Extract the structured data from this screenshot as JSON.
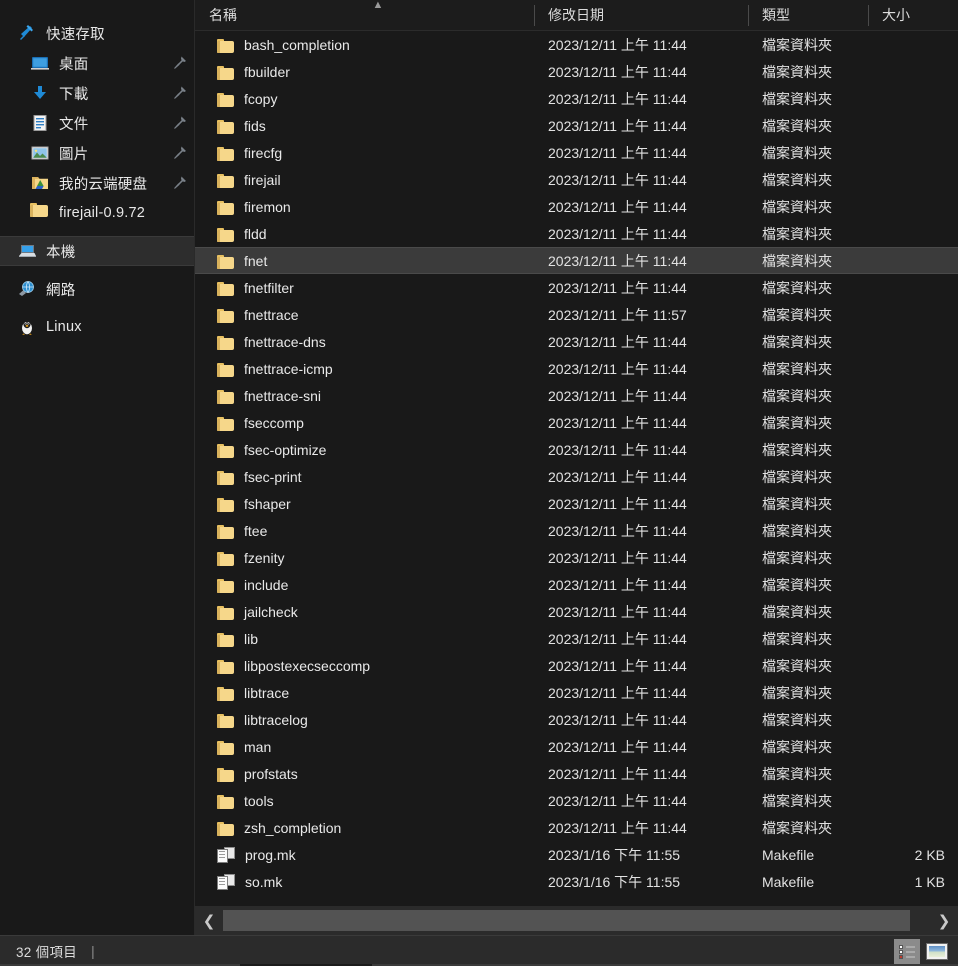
{
  "window": {
    "background": "#191919",
    "accent": "#3b3b3b"
  },
  "sidebar": {
    "quick_access": {
      "label": "快速存取",
      "icon": "star-pin-icon"
    },
    "items": [
      {
        "label": "桌面",
        "icon": "desktop-icon",
        "pinned": true,
        "indent": true
      },
      {
        "label": "下載",
        "icon": "download-arrow-icon",
        "pinned": true,
        "indent": true
      },
      {
        "label": "文件",
        "icon": "documents-icon",
        "pinned": true,
        "indent": true
      },
      {
        "label": "圖片",
        "icon": "pictures-icon",
        "pinned": true,
        "indent": true
      },
      {
        "label": "我的云端硬盘",
        "icon": "google-drive-folder-icon",
        "pinned": true,
        "indent": true
      },
      {
        "label": "firejail-0.9.72",
        "icon": "folder-icon",
        "pinned": false,
        "indent": true
      }
    ],
    "groups": [
      {
        "label": "本機",
        "icon": "this-pc-icon",
        "selected": true
      },
      {
        "label": "網路",
        "icon": "network-icon",
        "selected": false
      },
      {
        "label": "Linux",
        "icon": "linux-penguin-icon",
        "selected": false
      }
    ]
  },
  "columns": [
    {
      "key": "name",
      "label": "名稱",
      "sorted": "asc",
      "sort_glyph": "▲"
    },
    {
      "key": "date",
      "label": "修改日期",
      "sorted": "",
      "sort_glyph": ""
    },
    {
      "key": "type",
      "label": "類型",
      "sorted": "",
      "sort_glyph": ""
    },
    {
      "key": "size",
      "label": "大小",
      "sorted": "",
      "sort_glyph": ""
    }
  ],
  "files": [
    {
      "name": "bash_completion",
      "date": "2023/12/11 上午 11:44",
      "type": "檔案資料夾",
      "size": "",
      "icon": "folder-icon",
      "selected": false
    },
    {
      "name": "fbuilder",
      "date": "2023/12/11 上午 11:44",
      "type": "檔案資料夾",
      "size": "",
      "icon": "folder-icon",
      "selected": false
    },
    {
      "name": "fcopy",
      "date": "2023/12/11 上午 11:44",
      "type": "檔案資料夾",
      "size": "",
      "icon": "folder-icon",
      "selected": false
    },
    {
      "name": "fids",
      "date": "2023/12/11 上午 11:44",
      "type": "檔案資料夾",
      "size": "",
      "icon": "folder-icon",
      "selected": false
    },
    {
      "name": "firecfg",
      "date": "2023/12/11 上午 11:44",
      "type": "檔案資料夾",
      "size": "",
      "icon": "folder-icon",
      "selected": false
    },
    {
      "name": "firejail",
      "date": "2023/12/11 上午 11:44",
      "type": "檔案資料夾",
      "size": "",
      "icon": "folder-icon",
      "selected": false
    },
    {
      "name": "firemon",
      "date": "2023/12/11 上午 11:44",
      "type": "檔案資料夾",
      "size": "",
      "icon": "folder-icon",
      "selected": false
    },
    {
      "name": "fldd",
      "date": "2023/12/11 上午 11:44",
      "type": "檔案資料夾",
      "size": "",
      "icon": "folder-icon",
      "selected": false
    },
    {
      "name": "fnet",
      "date": "2023/12/11 上午 11:44",
      "type": "檔案資料夾",
      "size": "",
      "icon": "folder-icon",
      "selected": true
    },
    {
      "name": "fnetfilter",
      "date": "2023/12/11 上午 11:44",
      "type": "檔案資料夾",
      "size": "",
      "icon": "folder-icon",
      "selected": false
    },
    {
      "name": "fnettrace",
      "date": "2023/12/11 上午 11:57",
      "type": "檔案資料夾",
      "size": "",
      "icon": "folder-icon",
      "selected": false
    },
    {
      "name": "fnettrace-dns",
      "date": "2023/12/11 上午 11:44",
      "type": "檔案資料夾",
      "size": "",
      "icon": "folder-icon",
      "selected": false
    },
    {
      "name": "fnettrace-icmp",
      "date": "2023/12/11 上午 11:44",
      "type": "檔案資料夾",
      "size": "",
      "icon": "folder-icon",
      "selected": false
    },
    {
      "name": "fnettrace-sni",
      "date": "2023/12/11 上午 11:44",
      "type": "檔案資料夾",
      "size": "",
      "icon": "folder-icon",
      "selected": false
    },
    {
      "name": "fseccomp",
      "date": "2023/12/11 上午 11:44",
      "type": "檔案資料夾",
      "size": "",
      "icon": "folder-icon",
      "selected": false
    },
    {
      "name": "fsec-optimize",
      "date": "2023/12/11 上午 11:44",
      "type": "檔案資料夾",
      "size": "",
      "icon": "folder-icon",
      "selected": false
    },
    {
      "name": "fsec-print",
      "date": "2023/12/11 上午 11:44",
      "type": "檔案資料夾",
      "size": "",
      "icon": "folder-icon",
      "selected": false
    },
    {
      "name": "fshaper",
      "date": "2023/12/11 上午 11:44",
      "type": "檔案資料夾",
      "size": "",
      "icon": "folder-icon",
      "selected": false
    },
    {
      "name": "ftee",
      "date": "2023/12/11 上午 11:44",
      "type": "檔案資料夾",
      "size": "",
      "icon": "folder-icon",
      "selected": false
    },
    {
      "name": "fzenity",
      "date": "2023/12/11 上午 11:44",
      "type": "檔案資料夾",
      "size": "",
      "icon": "folder-icon",
      "selected": false
    },
    {
      "name": "include",
      "date": "2023/12/11 上午 11:44",
      "type": "檔案資料夾",
      "size": "",
      "icon": "folder-icon",
      "selected": false
    },
    {
      "name": "jailcheck",
      "date": "2023/12/11 上午 11:44",
      "type": "檔案資料夾",
      "size": "",
      "icon": "folder-icon",
      "selected": false
    },
    {
      "name": "lib",
      "date": "2023/12/11 上午 11:44",
      "type": "檔案資料夾",
      "size": "",
      "icon": "folder-icon",
      "selected": false
    },
    {
      "name": "libpostexecseccomp",
      "date": "2023/12/11 上午 11:44",
      "type": "檔案資料夾",
      "size": "",
      "icon": "folder-icon",
      "selected": false
    },
    {
      "name": "libtrace",
      "date": "2023/12/11 上午 11:44",
      "type": "檔案資料夾",
      "size": "",
      "icon": "folder-icon",
      "selected": false
    },
    {
      "name": "libtracelog",
      "date": "2023/12/11 上午 11:44",
      "type": "檔案資料夾",
      "size": "",
      "icon": "folder-icon",
      "selected": false
    },
    {
      "name": "man",
      "date": "2023/12/11 上午 11:44",
      "type": "檔案資料夾",
      "size": "",
      "icon": "folder-icon",
      "selected": false
    },
    {
      "name": "profstats",
      "date": "2023/12/11 上午 11:44",
      "type": "檔案資料夾",
      "size": "",
      "icon": "folder-icon",
      "selected": false
    },
    {
      "name": "tools",
      "date": "2023/12/11 上午 11:44",
      "type": "檔案資料夾",
      "size": "",
      "icon": "folder-icon",
      "selected": false
    },
    {
      "name": "zsh_completion",
      "date": "2023/12/11 上午 11:44",
      "type": "檔案資料夾",
      "size": "",
      "icon": "folder-icon",
      "selected": false
    },
    {
      "name": "prog.mk",
      "date": "2023/1/16 下午 11:55",
      "type": "Makefile",
      "size": "2 KB",
      "icon": "makefile-document-icon",
      "selected": false
    },
    {
      "name": "so.mk",
      "date": "2023/1/16 下午 11:55",
      "type": "Makefile",
      "size": "1 KB",
      "icon": "makefile-document-icon",
      "selected": false
    }
  ],
  "hscroll": {
    "left_glyph": "❮",
    "right_glyph": "❯"
  },
  "statusbar": {
    "item_count_text": "32 個項目",
    "separator": "|",
    "views": [
      {
        "name": "details-view",
        "active": true
      },
      {
        "name": "thumbnails-view",
        "active": false
      }
    ]
  }
}
